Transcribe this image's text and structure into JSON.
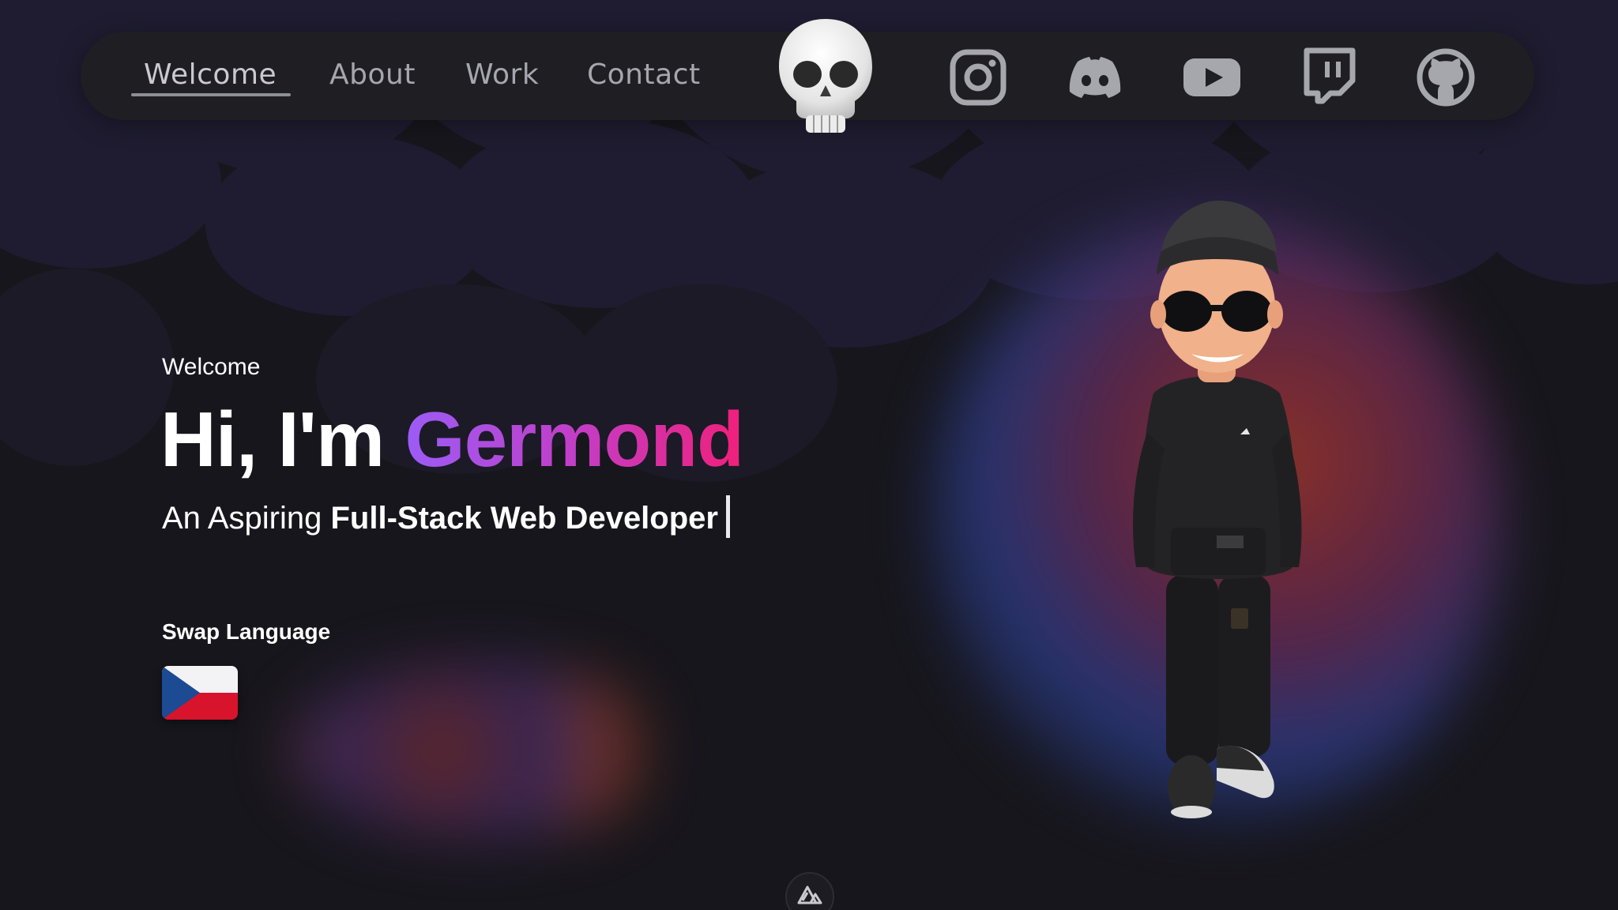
{
  "nav": {
    "links": [
      {
        "label": "Welcome",
        "active": true
      },
      {
        "label": "About",
        "active": false
      },
      {
        "label": "Work",
        "active": false
      },
      {
        "label": "Contact",
        "active": false
      }
    ],
    "logo_icon": "skull-icon",
    "social": [
      {
        "name": "instagram-icon"
      },
      {
        "name": "discord-icon"
      },
      {
        "name": "youtube-icon"
      },
      {
        "name": "twitch-icon"
      },
      {
        "name": "github-icon"
      }
    ]
  },
  "hero": {
    "eyebrow": "Welcome",
    "greeting": "Hi, I'm",
    "name": "Germond",
    "subtitle_prefix": "An Aspiring",
    "subtitle_bold": "Full-Stack Web Developer",
    "swap_label": "Swap Language",
    "flag_icon": "czech-flag-icon"
  },
  "colors": {
    "background": "#17161c",
    "navbar": "#1e1e23",
    "nav_text": "#a6a6ad",
    "gradient_start": "#9b5cf6",
    "gradient_end": "#f0207a"
  },
  "footer": {
    "badge_icon": "nuxt-icon"
  }
}
